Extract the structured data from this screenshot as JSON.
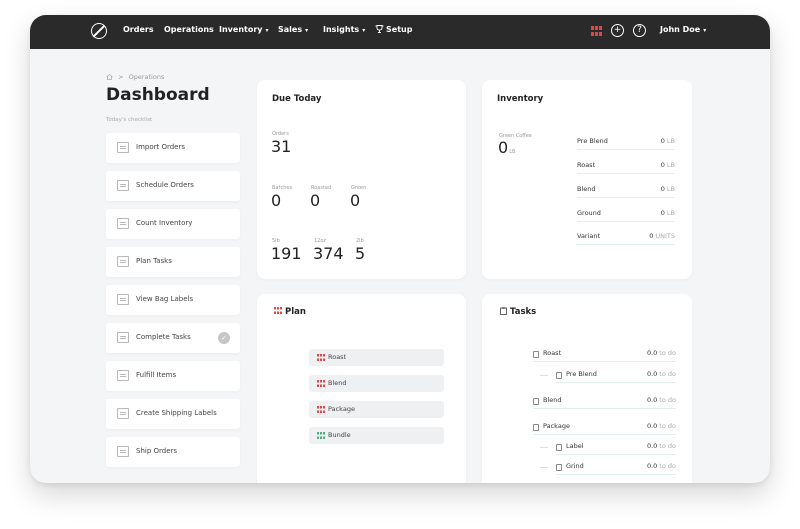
{
  "nav": {
    "items": [
      {
        "label": "Orders",
        "caret": ""
      },
      {
        "label": "Operations",
        "caret": ""
      },
      {
        "label": "Inventory",
        "caret": "▾"
      },
      {
        "label": "Sales",
        "caret": "▾"
      },
      {
        "label": "Insights",
        "caret": "▾"
      },
      {
        "label": "Setup",
        "caret": ""
      }
    ],
    "user": "John Doe",
    "user_caret": "▾",
    "colors": {
      "bar": "#2a2a2a",
      "accent": "#e04848"
    }
  },
  "breadcrumb": {
    "home_icon": "home-icon",
    "separator": ">",
    "current": "Operations"
  },
  "page_title": "Dashboard",
  "checklist": {
    "label": "Today's checklist",
    "items": [
      {
        "label": "Import Orders",
        "icon": "import-icon",
        "done": false
      },
      {
        "label": "Schedule Orders",
        "icon": "calendar-icon",
        "done": false
      },
      {
        "label": "Count Inventory",
        "icon": "inventory-icon",
        "done": false
      },
      {
        "label": "Plan Tasks",
        "icon": "plan-icon",
        "done": false
      },
      {
        "label": "View Bag Labels",
        "icon": "label-icon",
        "done": false
      },
      {
        "label": "Complete Tasks",
        "icon": "clipboard-icon",
        "done": true
      },
      {
        "label": "Fulfill Items",
        "icon": "fulfill-icon",
        "done": false
      },
      {
        "label": "Create Shipping Labels",
        "icon": "shipping-label-icon",
        "done": false
      },
      {
        "label": "Ship Orders",
        "icon": "truck-icon",
        "done": false
      }
    ]
  },
  "due_today": {
    "title": "Due Today",
    "orders": {
      "label": "Orders",
      "value": "31"
    },
    "row2": [
      {
        "label": "Batches",
        "value": "0"
      },
      {
        "label": "Roasted",
        "value": "0"
      },
      {
        "label": "Green",
        "value": "0"
      }
    ],
    "row3": [
      {
        "label": "5lb",
        "value": "191"
      },
      {
        "label": "12oz",
        "value": "374"
      },
      {
        "label": "2lb",
        "value": "5"
      }
    ]
  },
  "inventory": {
    "title": "Inventory",
    "green_coffee": {
      "label": "Green Coffee",
      "value": "0",
      "unit": "LB"
    },
    "rows": [
      {
        "name": "Pre Blend",
        "value": "0",
        "unit": "LB"
      },
      {
        "name": "Roast",
        "value": "0",
        "unit": "LB"
      },
      {
        "name": "Blend",
        "value": "0",
        "unit": "LB"
      },
      {
        "name": "Ground",
        "value": "0",
        "unit": "LB"
      },
      {
        "name": "Variant",
        "value": "0",
        "unit": "UNITS"
      }
    ]
  },
  "plan": {
    "title": "Plan",
    "items": [
      {
        "label": "Roast",
        "color": "#e04848"
      },
      {
        "label": "Blend",
        "color": "#e04848"
      },
      {
        "label": "Package",
        "color": "#e04848"
      },
      {
        "label": "Bundle",
        "color": "#4cb07a"
      }
    ]
  },
  "tasks": {
    "title": "Tasks",
    "rows": [
      {
        "name": "Roast",
        "value": "0.0",
        "unit": "to do",
        "child": false
      },
      {
        "name": "Pre Blend",
        "value": "0.0",
        "unit": "to do",
        "child": true
      },
      {
        "name": "Blend",
        "value": "0.0",
        "unit": "to do",
        "child": false
      },
      {
        "name": "Package",
        "value": "0.0",
        "unit": "to do",
        "child": false
      },
      {
        "name": "Label",
        "value": "0.0",
        "unit": "to do",
        "child": true
      },
      {
        "name": "Grind",
        "value": "0.0",
        "unit": "to do",
        "child": true
      }
    ]
  }
}
